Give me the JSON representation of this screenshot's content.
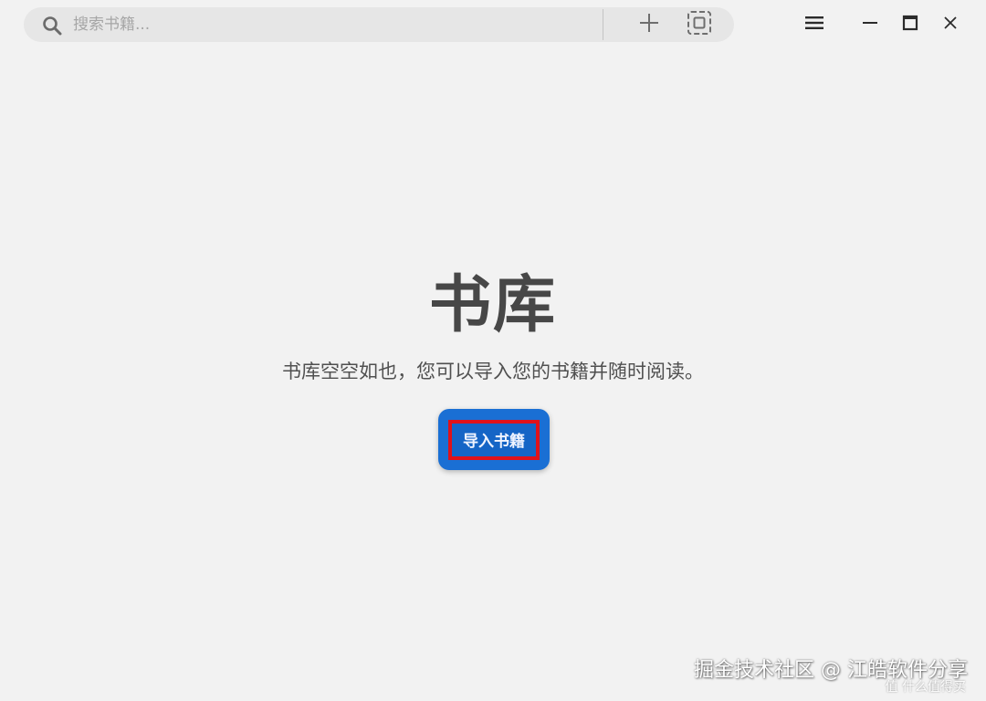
{
  "search": {
    "placeholder": "搜索书籍..."
  },
  "toolbar": {
    "add_icon": "plus-icon",
    "fullscreen_icon": "fullscreen-icon"
  },
  "window_controls": {
    "menu_icon": "hamburger-menu-icon",
    "minimize_icon": "minimize-icon",
    "maximize_icon": "maximize-icon",
    "close_icon": "close-icon"
  },
  "library": {
    "title": "书库",
    "empty_message": "书库空空如也，您可以导入您的书籍并随时阅读。",
    "import_button_label": "导入书籍"
  },
  "watermark": {
    "main": "掘金技术社区 @ 江皓软件分享",
    "sub": "值 什么值得买"
  },
  "colors": {
    "background": "#f2f2f2",
    "search_bg": "#e6e6e6",
    "button_blue": "#1565c6",
    "highlight_red": "#e0121a",
    "title_text": "#474747"
  }
}
